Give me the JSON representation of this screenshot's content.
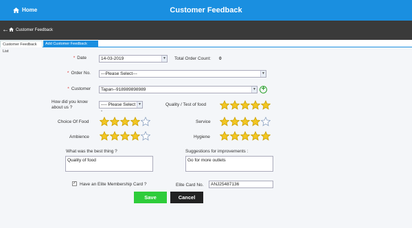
{
  "header": {
    "home_label": "Home",
    "title": "Customer Feedback"
  },
  "breadcrumb": {
    "label": "Customer Feedback"
  },
  "tabs": [
    {
      "label": "Customer Feedback List"
    },
    {
      "label": "Add Customer Feedback"
    }
  ],
  "form": {
    "date_label": "Date",
    "date_value": "14-03-2019",
    "total_order_count_label": "Total Order Count:",
    "total_order_count_value": "0",
    "order_no_label": "Order No.",
    "order_no_value": "---Please Select---",
    "customer_label": "Customer",
    "customer_value": "Tapan--918989898989",
    "how_know_label": "How did you know about us ?",
    "how_know_value": "---- Please Select ----",
    "quality_label": "Quality / Test of food",
    "quality_rating": 5,
    "choice_label": "Choice Of Food",
    "choice_rating": 4,
    "service_label": "Service",
    "service_rating": 4,
    "ambience_label": "Ambience",
    "ambience_rating": 4,
    "hygiene_label": "Hygiene",
    "hygiene_rating": 5,
    "best_thing_label": "What was the best thing ?",
    "best_thing_value": "Quality of food",
    "suggestions_label": "Suggestions for improvements :",
    "suggestions_value": "Go for more outlets",
    "elite_label": "Have an Elite Membership Card ?",
    "elite_checked": true,
    "elite_card_label": "Elite Card No.",
    "elite_card_value": "ANJ25487136"
  },
  "buttons": {
    "save": "Save",
    "cancel": "Cancel"
  },
  "colors": {
    "header_blue": "#1a8fe0",
    "dark_bar": "#3a3a3a",
    "save_green": "#2ecc3a",
    "star_gold": "#f3c623"
  }
}
